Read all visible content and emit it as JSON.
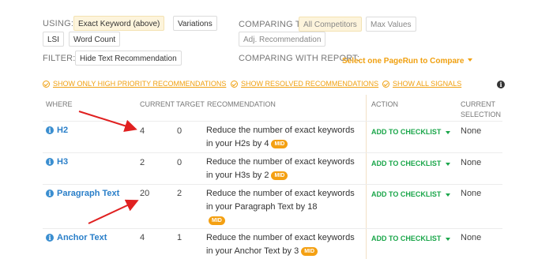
{
  "controls": {
    "using_label": "USING:",
    "using_options": [
      {
        "label": "Exact Keyword (above)",
        "selected": true
      },
      {
        "label": "Variations",
        "selected": false
      },
      {
        "label": "LSI",
        "selected": false
      },
      {
        "label": "Word Count",
        "selected": false
      }
    ],
    "filter_label": "FILTER:",
    "filter_option": "Hide Text Recommendation",
    "comparing_label": "COMPARING TO:",
    "comparing_options": [
      {
        "label": "All Competitors",
        "selected": true
      },
      {
        "label": "Max Values",
        "selected": false
      },
      {
        "label": "Adj. Recommendation",
        "selected": false
      }
    ],
    "report_label": "COMPARING WITH REPORT:",
    "report_value": "Select one PageRun to Compare"
  },
  "filters": [
    "SHOW ONLY HIGH PRIORITY RECOMMENDATIONS",
    "SHOW RESOLVED RECOMMENDATIONS",
    "SHOW ALL SIGNALS"
  ],
  "table": {
    "headers": {
      "where": "WHERE",
      "current": "CURRENT",
      "target": "TARGET",
      "recommendation": "RECOMMENDATION",
      "action": "ACTION",
      "current_selection_1": "CURRENT",
      "current_selection_2": "SELECTION"
    },
    "rows": [
      {
        "where": "H2",
        "current": "4",
        "target": "0",
        "rec_line1": "Reduce the number of exact keywords",
        "rec_line2": "in your H2s by 4",
        "badge": "MID",
        "action": "ADD TO CHECKLIST",
        "selection": "None"
      },
      {
        "where": "H3",
        "current": "2",
        "target": "0",
        "rec_line1": "Reduce the number of exact keywords",
        "rec_line2": "in your H3s by 2",
        "badge": "MID",
        "action": "ADD TO CHECKLIST",
        "selection": "None"
      },
      {
        "where": "Paragraph Text",
        "current": "20",
        "target": "2",
        "rec_line1": "Reduce the number of exact keywords",
        "rec_line2": "in your Paragraph Text by 18",
        "badge": "MID",
        "action": "ADD TO CHECKLIST",
        "selection": "None"
      },
      {
        "where": "Anchor Text",
        "current": "4",
        "target": "1",
        "rec_line1": "Reduce the number of exact keywords",
        "rec_line2": "in your Anchor Text by 3",
        "badge": "MID",
        "action": "ADD TO CHECKLIST",
        "selection": "None"
      }
    ]
  },
  "colors": {
    "accent": "#f0a010",
    "link": "#2a7fc9",
    "action": "#1aa64a",
    "arrow": "#e02020"
  }
}
